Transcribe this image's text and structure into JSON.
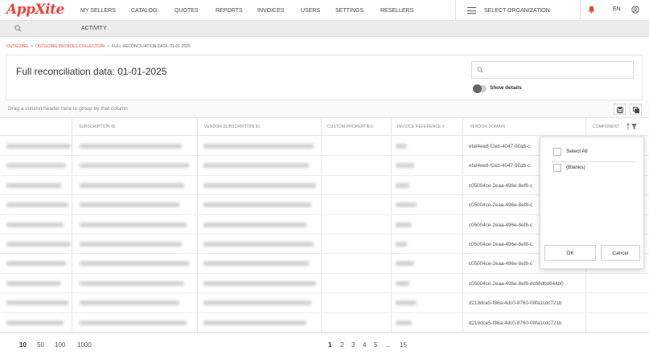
{
  "app": {
    "logo_text": "AppXite",
    "brand_color": "#e8453c"
  },
  "nav": {
    "items": [
      "MY SELLERS",
      "CATALOG",
      "QUOTES",
      "REPORTS",
      "INVOICES",
      "USERS",
      "SETTINGS",
      "RESELLERS"
    ],
    "org_selector": "SELECT ORGANIZATION",
    "language": "EN"
  },
  "subbar": {
    "activity": "ACTIVITY"
  },
  "breadcrumb": {
    "items": [
      "OUTGOING",
      "OUTGOING INVOICES COLLECTION",
      "FULL RECONCILIATION DATA: 01-01-2025"
    ],
    "separator": ">"
  },
  "page": {
    "title": "Full reconciliation data: 01-01-2025",
    "search_placeholder": "",
    "show_details_label": "Show details",
    "show_details_on": false
  },
  "grid": {
    "group_hint": "Drag a column header here to group by that column",
    "columns": [
      "",
      "SUBSCRIPTION ID",
      "VENDOR SUBSCRIPTION ID",
      "CUSTOM PROPERTIES",
      "INVOICE REFERENCE #",
      "VENDOR DOMAIN",
      "COMPONENT"
    ],
    "sort_indicator": "↑",
    "rows": [
      {
        "vendor_domain": "efaf4ee8-f2eb-4047-90ab-c"
      },
      {
        "vendor_domain": "efaf4ee8-f2eb-4047-90ab-c"
      },
      {
        "vendor_domain": "c05004ce-2eaa-496e-8ef8-c"
      },
      {
        "vendor_domain": "c05004ce-2eaa-496e-8ef8-c"
      },
      {
        "vendor_domain": "c05004ce-2eaa-496e-8ef8-c"
      },
      {
        "vendor_domain": "c05004ce-2eaa-496e-8ef8-c"
      },
      {
        "vendor_domain": "c05004ce-2eaa-496e-8ef8-c"
      },
      {
        "vendor_domain": "c05004ce-2eaa-496e-8ef8-dcb6dbd644b0"
      },
      {
        "vendor_domain": "d219dce5-f86a-4dc0-8760-08fa1cdc721b"
      },
      {
        "vendor_domain": "d219dce5-f86a-4dc0-8760-08fa1cdc721b"
      }
    ]
  },
  "filter_popup": {
    "options": [
      "Select All",
      "(Blanks)"
    ],
    "ok_label": "OK",
    "cancel_label": "Cancel"
  },
  "footer": {
    "page_sizes": [
      "10",
      "50",
      "100",
      "1000"
    ],
    "selected_page_size": "10",
    "pages": [
      "1",
      "2",
      "3",
      "4",
      "5",
      "...",
      "15"
    ],
    "current_page": "1"
  }
}
